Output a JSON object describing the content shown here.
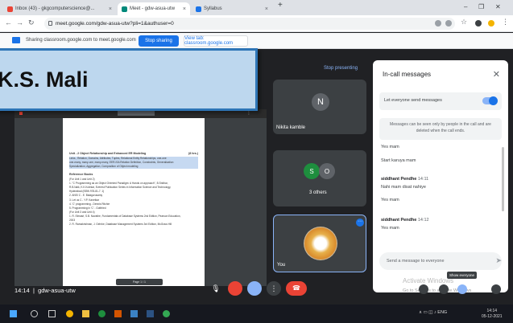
{
  "browser": {
    "tabs": [
      {
        "title": "Inbox (43) - gkgcomputerscience@..."
      },
      {
        "title": "Meet - gdw-asua-utw"
      },
      {
        "title": "Syllabus"
      }
    ],
    "new_tab": "+",
    "url": "meet.google.com/gdw-asua-utw?pli=1&authuser=0"
  },
  "sharebar": {
    "text": "Sharing classroom.google.com to meet.google.com",
    "stop_label": "Stop sharing",
    "view_label": "View tab: classroom.google.com"
  },
  "meet": {
    "stop_presenting": "Stop presenting",
    "banner_name": "K.S. Mali",
    "doc": {
      "unit_title": "Unit - 2 Object Relationship and Enhanced ER Modeling",
      "unit_hours": "(8 hrs.)",
      "unit_body_1": "Links , Relation, Domains, Attributes, Tuples, Relational Entity Relationships, one-one",
      "unit_body_2": "one-many, many-one, many-many, EER-ISA Relation Definition, Constraints, Generalization",
      "unit_body_3": "Specialization, Aggregation, Composition of Object modeling",
      "ref_heading": "Reference Books",
      "ref_sub": "(For Unit 1 and Unit 2)",
      "refs": [
        "1. \"C Programming as an Object Oriented Paradigm: A Hands on approach\", B.Sridhar,",
        "   R.B.Naik, K.K.Kolekar, Everest Publication Series in Information Science and Technology,",
        "   Hyderabad (ISBN 978-81-7. 1)",
        "2. ANSI C - E. Balagurusamy",
        "3. Let us C - Y.P. Kanetkar",
        "4. 'C' programming - Dennis Ritchie",
        "5. Programming in 'C' - Gottfried",
        "(For Unit 3 and Unit 4)",
        "1. R. Elmasri, S.B. Navathe, Fundamentals of Database Systems 2nd Edition, Pearson Education,",
        "   2003",
        "2. R. Ramakrishnan, J. Gehrke, Database Management Systems 3rd Edition, McGraw-Hill"
      ],
      "page_bar": "Page 1 / 1"
    },
    "participants": [
      {
        "initial": "N",
        "name": "Nikita kamble"
      },
      {
        "avatars": [
          "S",
          "O"
        ],
        "name": "3 others"
      },
      {
        "name": "You"
      }
    ],
    "clock": "14:14",
    "meeting_code": "gdw-asua-utw",
    "activate_title": "Activate Windows",
    "activate_sub": "Go to Settings to activate Windows.",
    "tooltip": "Show everyone"
  },
  "chat": {
    "title": "In-call messages",
    "toggle_label": "Let everyone send messages",
    "info": "Messages can be seen only by people in the call and are deleted when the call ends.",
    "messages": [
      {
        "text": "Yes mam"
      },
      {
        "text": "Start karuya mam"
      },
      {
        "sender": "siddhant Pendhe",
        "time": "14:11",
        "text": "Nahi mam disat nahiye"
      },
      {
        "text": "Yes mam"
      },
      {
        "sender": "siddhant Pendhe",
        "time": "14:12",
        "text": "Yes mam"
      }
    ],
    "input_placeholder": "Send a message to everyone"
  },
  "taskbar": {
    "lang": "ENG",
    "time": "14:14",
    "date": "05-12-2021"
  },
  "colors": {
    "accent": "#1a73e8",
    "end_call": "#ea4335",
    "banner_bg": "#bdd7ee",
    "banner_border": "#2e75b6"
  }
}
